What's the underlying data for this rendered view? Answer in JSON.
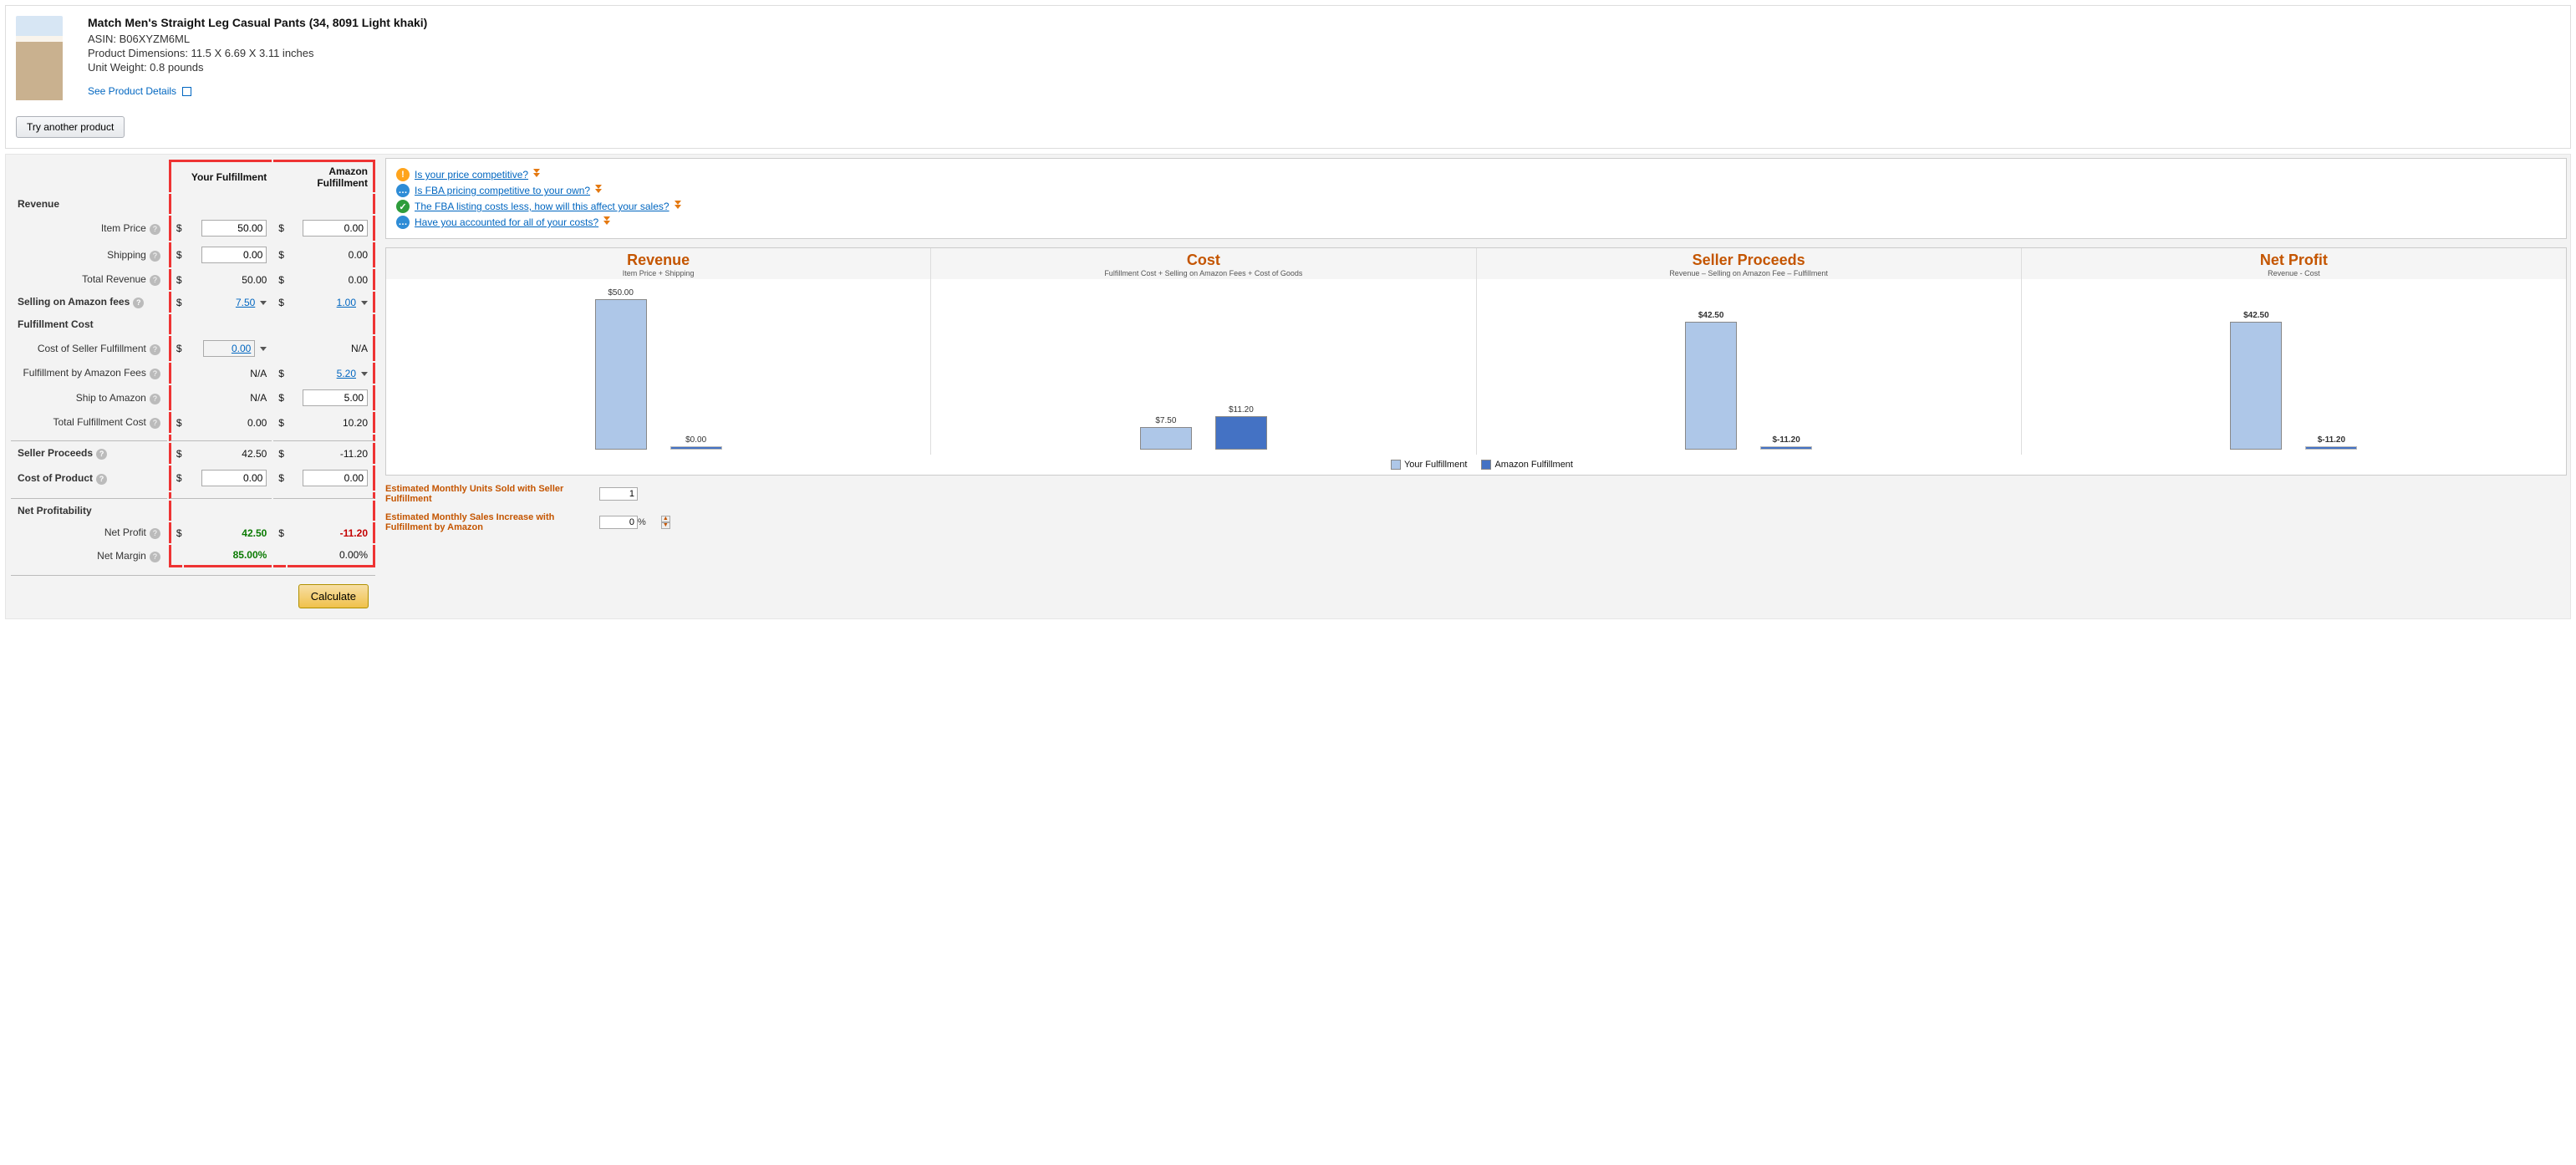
{
  "product": {
    "title": "Match Men's Straight Leg Casual Pants (34, 8091 Light khaki)",
    "asin_label": "ASIN: B06XYZM6ML",
    "dimensions_label": "Product Dimensions: 11.5 X 6.69 X 3.11 inches",
    "weight_label": "Unit Weight: 0.8 pounds",
    "details_link": "See Product Details",
    "try_another": "Try another product"
  },
  "headers": {
    "yf": "Your Fulfillment",
    "af": "Amazon Fulfillment"
  },
  "sections": {
    "revenue": "Revenue",
    "selling_fees": "Selling on Amazon fees",
    "fulfillment_cost": "Fulfillment Cost",
    "seller_proceeds": "Seller Proceeds",
    "cost_of_product": "Cost of Product",
    "net_profitability": "Net Profitability"
  },
  "rows": {
    "item_price": "Item Price",
    "shipping": "Shipping",
    "total_revenue": "Total Revenue",
    "cost_seller_fulfillment": "Cost of Seller Fulfillment",
    "fba_fees": "Fulfillment by Amazon Fees",
    "ship_to_amazon": "Ship to Amazon",
    "total_fulfillment_cost": "Total Fulfillment Cost",
    "net_profit": "Net Profit",
    "net_margin": "Net Margin"
  },
  "values": {
    "yf_item_price": "50.00",
    "af_item_price": "0.00",
    "yf_shipping": "0.00",
    "af_shipping": "0.00",
    "yf_total_revenue": "50.00",
    "af_total_revenue": "0.00",
    "yf_selling_fees": "7.50",
    "af_selling_fees": "1.00",
    "yf_cost_seller_fulfillment": "0.00",
    "af_cost_seller_fulfillment": "N/A",
    "yf_fba_fees": "N/A",
    "af_fba_fees": "5.20",
    "yf_ship_to_amazon": "N/A",
    "af_ship_to_amazon": "5.00",
    "yf_total_fulfillment": "0.00",
    "af_total_fulfillment": "10.20",
    "yf_seller_proceeds": "42.50",
    "af_seller_proceeds": "-11.20",
    "yf_cost_of_product": "0.00",
    "af_cost_of_product": "0.00",
    "yf_net_profit": "42.50",
    "af_net_profit": "-11.20",
    "yf_net_margin": "85.00%",
    "af_net_margin": "0.00%"
  },
  "na": "N/A",
  "calculate": "Calculate",
  "notes": {
    "q1": "Is your price competitive?",
    "q2": "Is FBA pricing competitive to your own?",
    "q3": "The FBA listing costs less, how will this affect your sales?",
    "q4": "Have you accounted for all of your costs?"
  },
  "chart": {
    "revenue": {
      "title": "Revenue",
      "sub": "Item Price + Shipping"
    },
    "cost": {
      "title": "Cost",
      "sub": "Fulfillment Cost + Selling on Amazon Fees + Cost of Goods"
    },
    "proceeds": {
      "title": "Seller Proceeds",
      "sub": "Revenue – Selling on Amazon Fee – Fulfillment"
    },
    "netprofit": {
      "title": "Net Profit",
      "sub": "Revenue - Cost"
    }
  },
  "chart_data": {
    "type": "bar",
    "series_labels": {
      "yf": "Your Fulfillment",
      "af": "Amazon Fulfillment"
    },
    "panels": [
      {
        "name": "Revenue",
        "yf": {
          "label": "$50.00",
          "value": 50.0
        },
        "af": {
          "label": "$0.00",
          "value": 0.0
        }
      },
      {
        "name": "Cost",
        "yf": {
          "label": "$7.50",
          "value": 7.5
        },
        "af": {
          "label": "$11.20",
          "value": 11.2
        }
      },
      {
        "name": "Seller Proceeds",
        "yf": {
          "label": "$42.50",
          "value": 42.5,
          "color": "green"
        },
        "af": {
          "label": "$-11.20",
          "value": -11.2,
          "color": "red"
        }
      },
      {
        "name": "Net Profit",
        "yf": {
          "label": "$42.50",
          "value": 42.5,
          "color": "green"
        },
        "af": {
          "label": "$-11.20",
          "value": -11.2,
          "color": "red"
        }
      }
    ],
    "ymax": 50
  },
  "legend": {
    "yf": "Your Fulfillment",
    "af": "Amazon Fulfillment"
  },
  "est": {
    "monthly_units_label": "Estimated Monthly Units Sold with Seller Fulfillment",
    "monthly_units_value": "1",
    "sales_increase_label": "Estimated Monthly Sales Increase with Fulfillment by Amazon",
    "sales_increase_value": "0",
    "percent": "%"
  }
}
